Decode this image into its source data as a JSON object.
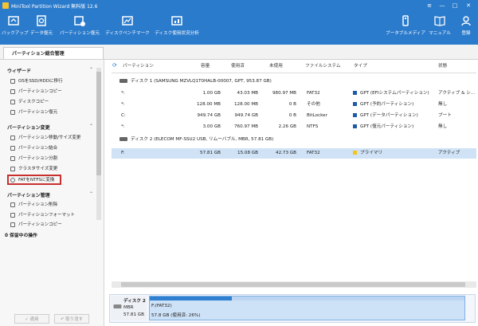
{
  "app": {
    "title": "MiniTool Partition Wizard 無料版 12.6",
    "window_controls": [
      "≡",
      "—",
      "□",
      "✕"
    ]
  },
  "toolbar": {
    "left": [
      {
        "label": "バックアップ",
        "icon": "backup-icon"
      },
      {
        "label": "データ復元",
        "icon": "data-recovery-icon"
      },
      {
        "label": "パーティション復元",
        "icon": "partition-recovery-icon"
      },
      {
        "label": "ディスクベンチマーク",
        "icon": "disk-benchmark-icon"
      },
      {
        "label": "ディスク使用状況分析",
        "icon": "space-analyzer-icon"
      }
    ],
    "right": [
      {
        "label": "ブータブルメディア",
        "icon": "bootable-media-icon"
      },
      {
        "label": "マニュアル",
        "icon": "manual-icon"
      },
      {
        "label": "登録",
        "icon": "register-icon"
      }
    ]
  },
  "tab": {
    "label": "パーティション総合管理"
  },
  "sidebar": {
    "wizard": {
      "title": "ウィザード",
      "items": [
        "OSをSSD/HDDに移行",
        "パーティションコピー",
        "ディスクコピー",
        "パーティション復元"
      ]
    },
    "change": {
      "title": "パーティション変更",
      "items": [
        "パーティション移動/サイズ変更",
        "パーティション結合",
        "パーティション分割",
        "クラスタサイズ変更",
        "FATをNTFSに変換"
      ]
    },
    "manage": {
      "title": "パーティション管理",
      "items": [
        "パーティション削除",
        "パーティションフォーマット",
        "パーティションコピー"
      ]
    },
    "pending": "0 保留中の操作",
    "apply_label": "✓ 適用",
    "undo_label": "↶ 取り消す"
  },
  "table": {
    "columns": [
      "パーティション",
      "容量",
      "使用済",
      "未使用",
      "ファイルシステム",
      "タイプ",
      "状態"
    ],
    "disk1": "ディスク 1 (SAMSUNG MZVLQ1T0HALB-00007, GPT, 953.87 GB)",
    "disk1_rows": [
      {
        "partition": "*:",
        "capacity": "1.00 GB",
        "used": "43.03 MB",
        "unused": "980.97 MB",
        "fs": "FAT32",
        "type": "GPT (EFIシステムパーティション)",
        "status": "アクティブ & シ..."
      },
      {
        "partition": "*:",
        "capacity": "128.00 MB",
        "used": "128.00 MB",
        "unused": "0 B",
        "fs": "その他",
        "type": "GPT (予約パーティション)",
        "status": "無し"
      },
      {
        "partition": "C:",
        "capacity": "949.74 GB",
        "used": "949.74 GB",
        "unused": "0 B",
        "fs": "BitLocker",
        "type": "GPT (データパーティション)",
        "status": "ブート"
      },
      {
        "partition": "*:",
        "capacity": "3.00 GB",
        "used": "760.97 MB",
        "unused": "2.26 GB",
        "fs": "NTFS",
        "type": "GPT (復元パーティション)",
        "status": "無し"
      }
    ],
    "disk2": "ディスク 2 (ELECOM MF-SSU2 USB, リムーバブル, MBR, 57.81 GB)",
    "disk2_rows": [
      {
        "partition": "F:",
        "capacity": "57.81 GB",
        "used": "15.08 GB",
        "unused": "42.73 GB",
        "fs": "FAT32",
        "type": "プライマリ",
        "status": "アクティブ"
      }
    ]
  },
  "diskmap": {
    "name": "ディスク 2",
    "scheme": "MBR",
    "size": "57.81 GB",
    "partition_label": "F:(FAT32)",
    "partition_detail": "57.8 GB (使用済: 26%)",
    "used_fraction": 0.26
  },
  "colors": {
    "accent": "#2b7bcc",
    "selection": "#cfe2f6",
    "highlight_box": "#c83030"
  }
}
